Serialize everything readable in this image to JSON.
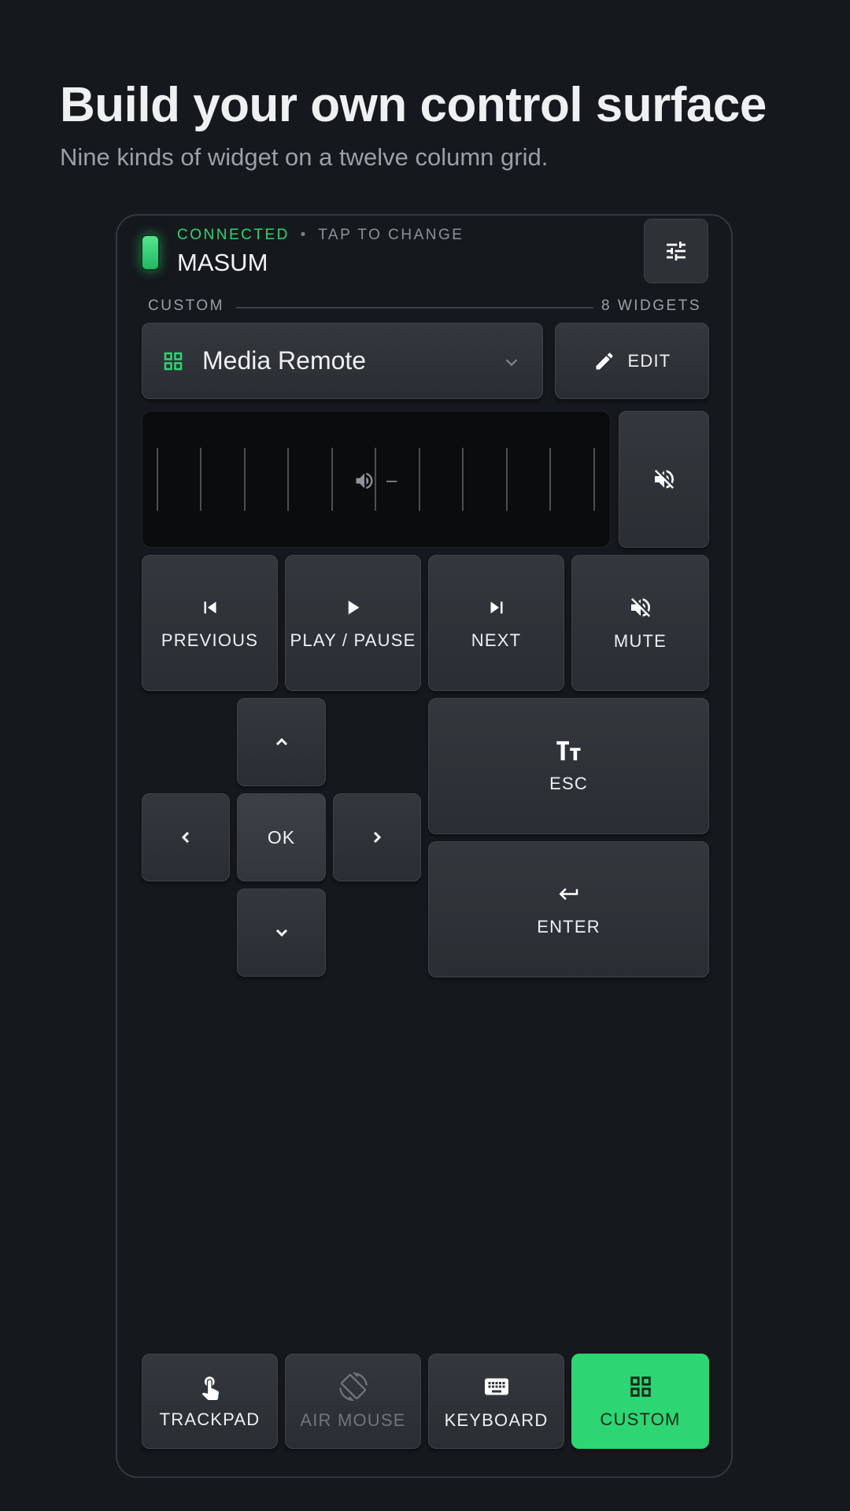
{
  "hero": {
    "title": "Build your own control surface",
    "subtitle": "Nine kinds of widget on a twelve column grid."
  },
  "status": {
    "state": "CONNECTED",
    "separator": "•",
    "hint": "TAP TO CHANGE",
    "device": "MASUM",
    "accent": "#2ed573"
  },
  "section": {
    "label": "CUSTOM",
    "count": "8 WIDGETS"
  },
  "layout": {
    "name": "Media Remote",
    "edit_label": "EDIT"
  },
  "volume": {
    "value_text": "–",
    "mute_icon": "volume-off-icon"
  },
  "media": {
    "previous": "PREVIOUS",
    "play_pause": "PLAY / PAUSE",
    "next": "NEXT",
    "mute": "MUTE"
  },
  "dpad": {
    "ok": "OK"
  },
  "keys": {
    "esc": "ESC",
    "enter": "ENTER"
  },
  "nav": {
    "trackpad": "TRACKPAD",
    "air_mouse": "AIR MOUSE",
    "keyboard": "KEYBOARD",
    "custom": "CUSTOM",
    "active": "CUSTOM"
  }
}
